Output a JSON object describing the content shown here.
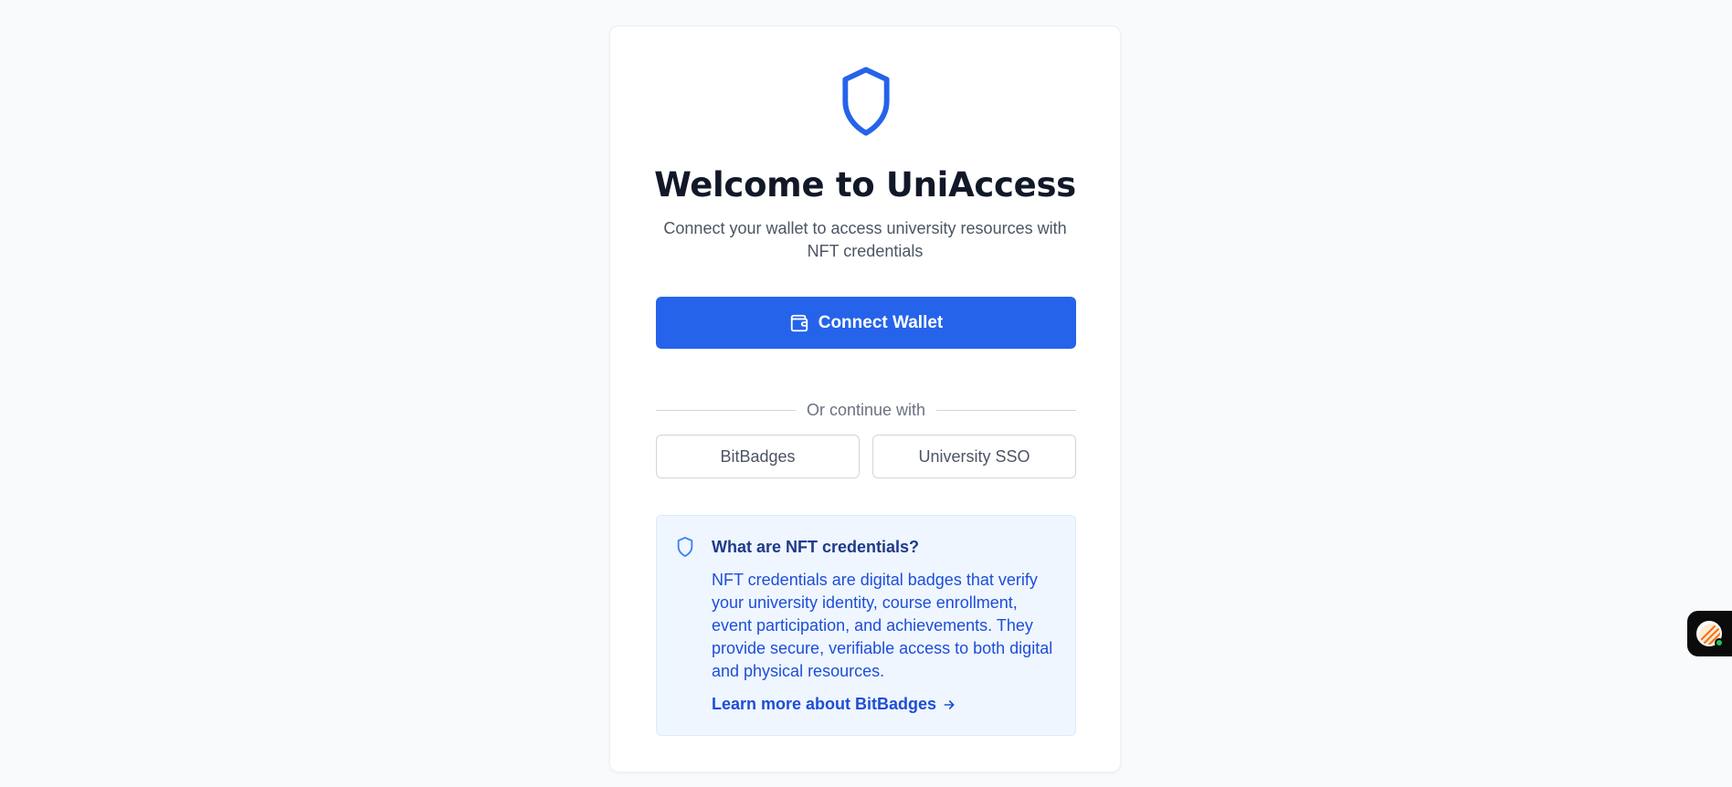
{
  "login": {
    "logo_icon": "shield-icon",
    "title": "Welcome to UniAccess",
    "subtitle": "Connect your wallet to access university resources with NFT credentials",
    "connect_button": {
      "label": "Connect Wallet",
      "icon": "wallet-icon"
    },
    "divider_text": "Or continue with",
    "alt_buttons": [
      {
        "label": "BitBadges"
      },
      {
        "label": "University SSO"
      }
    ]
  },
  "info_box": {
    "icon": "shield-icon",
    "title": "What are NFT credentials?",
    "body": "NFT credentials are digital badges that verify your university identity, course enrollment, event participation, and achievements. They provide secure, verifiable access to both digital and physical resources.",
    "link_label": "Learn more about BitBadges",
    "link_icon": "arrow-right-icon"
  },
  "chat_widget": {
    "icon": "chat-avatar-icon",
    "status_color": "#22c55e"
  },
  "colors": {
    "primary": "#2563eb",
    "background": "#f8fafc",
    "info_bg": "#eff6ff",
    "info_text": "#1d4ed8"
  }
}
